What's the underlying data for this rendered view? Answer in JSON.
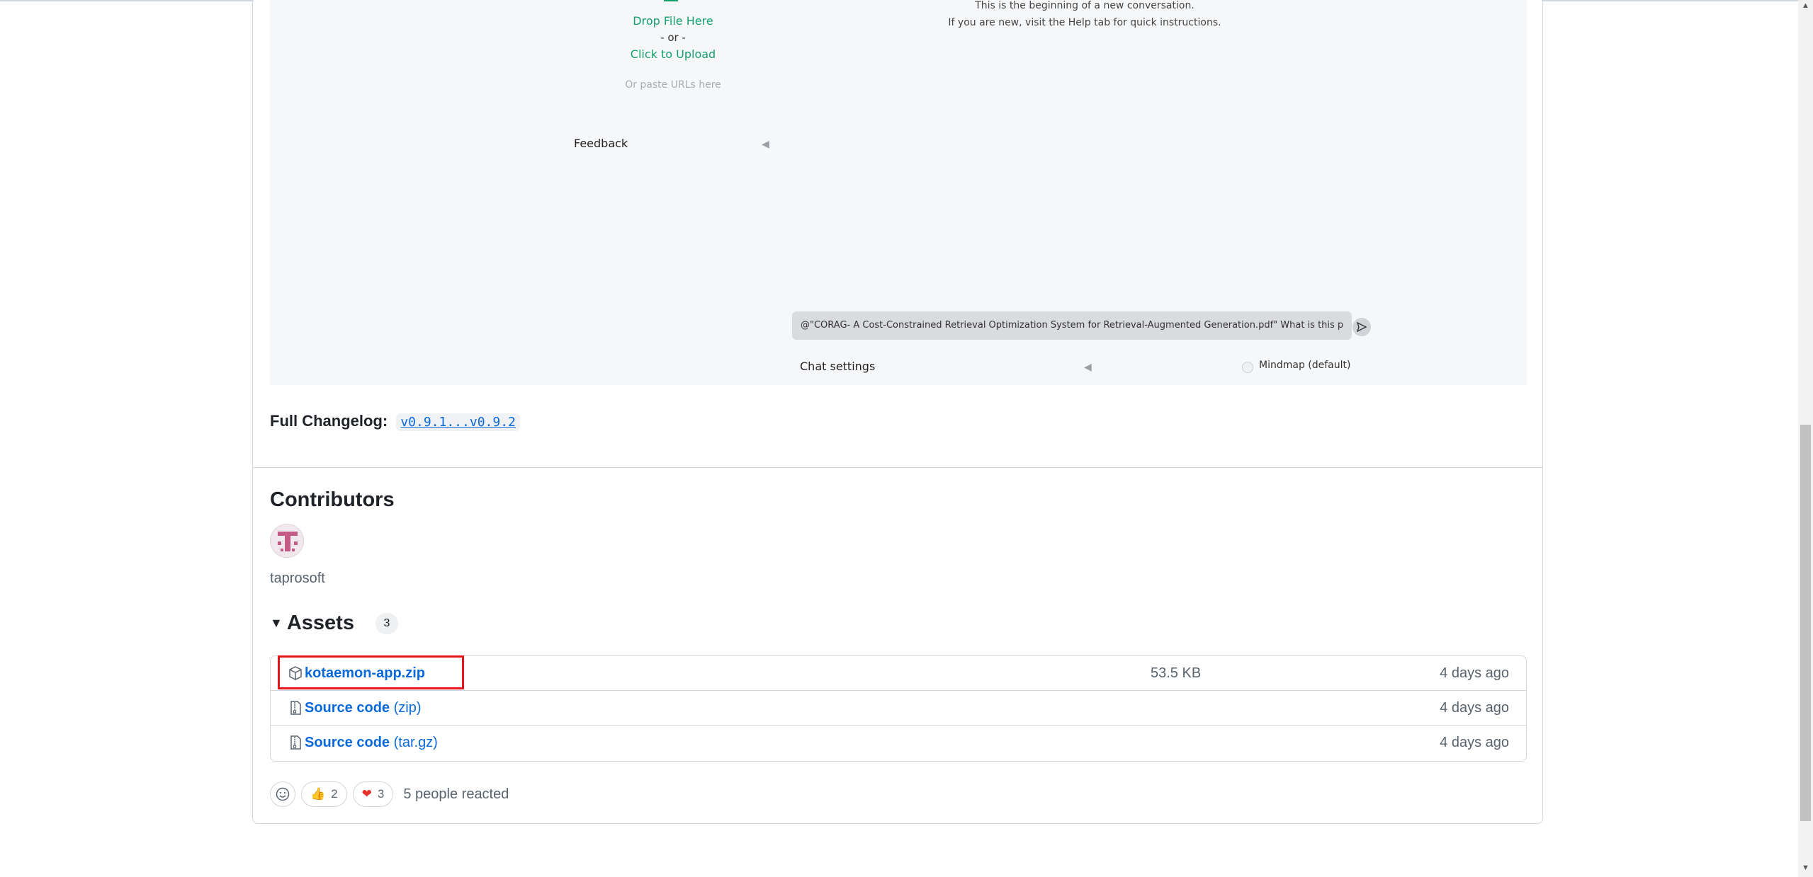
{
  "embedded_screenshot": {
    "drop_file": "Drop File Here",
    "or": "- or -",
    "click_upload": "Click to Upload",
    "paste_urls": "Or paste URLs here",
    "feedback": "Feedback",
    "message_line1": "This is the beginning of a new conversation.",
    "message_line2": "If you are new, visit the Help tab for quick instructions.",
    "chat_input": "@\"CORAG- A Cost-Constrained Retrieval Optimization System for Retrieval-Augmented Generation.pdf\" What is this p",
    "chat_settings": "Chat settings",
    "mindmap_label": "Mindmap (default)"
  },
  "changelog": {
    "label": "Full Changelog:",
    "link": "v0.9.1...v0.9.2"
  },
  "contributors": {
    "title": "Contributors",
    "users": [
      {
        "name": "taprosoft"
      }
    ]
  },
  "assets": {
    "title": "Assets",
    "count": "3",
    "items": [
      {
        "name": "kotaemon-app.zip",
        "suffix": "",
        "size": "53.5 KB",
        "date": "4 days ago",
        "icon": "package-icon"
      },
      {
        "name": "Source code",
        "suffix": "(zip)",
        "size": "",
        "date": "4 days ago",
        "icon": "file-zip-icon"
      },
      {
        "name": "Source code",
        "suffix": "(tar.gz)",
        "size": "",
        "date": "4 days ago",
        "icon": "file-zip-icon"
      }
    ]
  },
  "reactions": {
    "thumbs_emoji": "👍",
    "thumbs_count": "2",
    "heart_emoji": "❤",
    "heart_count": "3",
    "summary": "5 people reacted"
  },
  "colors": {
    "link": "#0969da",
    "highlight": "#e8141b",
    "upload_green": "#14a06a"
  }
}
